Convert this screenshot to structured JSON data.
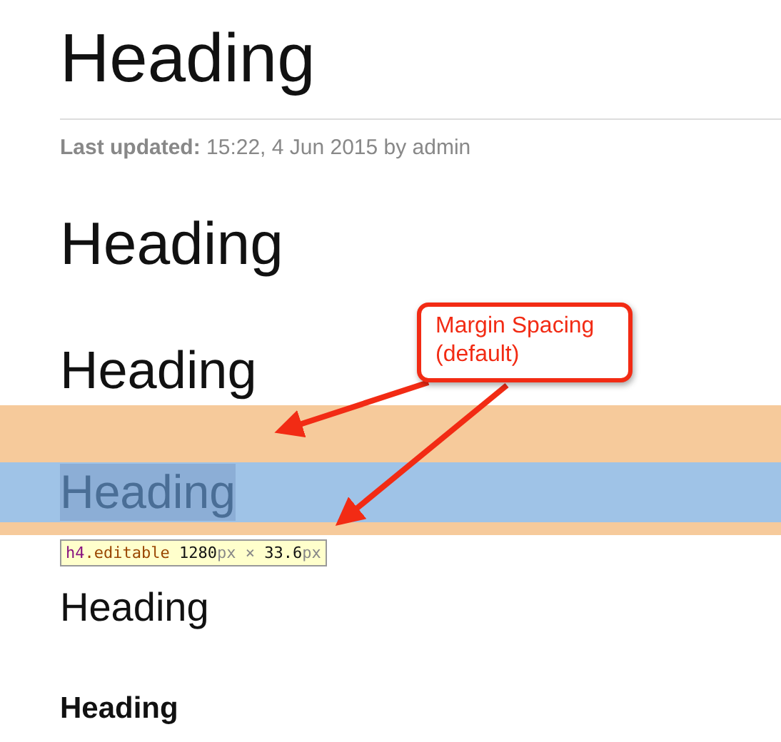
{
  "page_title": "Heading",
  "last_updated": "**Last updated:** 15:22, 4 Jun 2015 by admin",
  "headings": [
    {
      "kind": "h2",
      "text": "Heading",
      "inspected": false
    },
    {
      "kind": "h3",
      "text": "Heading",
      "inspected": false
    },
    {
      "kind": "h4",
      "text": "Heading",
      "inspected": true
    },
    {
      "kind": "h5",
      "text": "Heading",
      "inspected": false
    },
    {
      "kind": "h6",
      "text": "Heading",
      "inspected": false
    }
  ],
  "inspector_tooltip": {
    "parts": [
      {
        "kind": "tag",
        "text": "h4"
      },
      {
        "kind": "class",
        "text": ".editable"
      },
      {
        "kind": "number",
        "text": " 1280"
      },
      {
        "kind": "unit",
        "text": "px"
      },
      {
        "kind": "unit",
        "text": " × "
      },
      {
        "kind": "number",
        "text": "33.6"
      },
      {
        "kind": "unit",
        "text": "px"
      }
    ]
  },
  "annotation": {
    "lines": [
      "Margin Spacing",
      "(default)"
    ]
  }
}
